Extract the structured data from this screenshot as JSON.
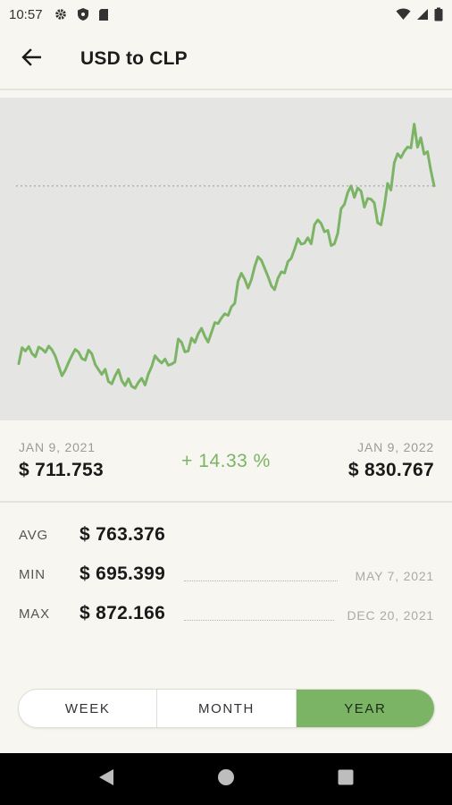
{
  "status_bar": {
    "time": "10:57"
  },
  "header": {
    "title": "USD to CLP"
  },
  "colors": {
    "accent": "#7cb466",
    "chart_bg": "#e5e5e3",
    "page_bg": "#f8f6f0"
  },
  "summary": {
    "start_date": "JAN 9, 2021",
    "start_value": "$ 711.753",
    "change": "+ 14.33 %",
    "end_date": "JAN 9, 2022",
    "end_value": "$ 830.767"
  },
  "stats": [
    {
      "label": "AVG",
      "value": "$ 763.376",
      "date": ""
    },
    {
      "label": "MIN",
      "value": "$ 695.399",
      "date": "MAY 7, 2021"
    },
    {
      "label": "MAX",
      "value": "$ 872.166",
      "date": "DEC 20, 2021"
    }
  ],
  "period_tabs": [
    {
      "label": "WEEK",
      "active": false
    },
    {
      "label": "MONTH",
      "active": false
    },
    {
      "label": "YEAR",
      "active": true
    }
  ],
  "chart_data": {
    "type": "line",
    "series": [
      {
        "values": [
          711.8,
          722.5,
          720.3,
          723.2,
          718.5,
          716.4,
          722.9,
          721.6,
          719.4,
          723.6,
          721.1,
          716.8,
          710.3,
          703.7,
          707.5,
          712.7,
          717.3,
          721.4,
          719.5,
          715.2,
          714.2,
          720.9,
          718.4,
          711.2,
          707.8,
          704.6,
          708.1,
          699.8,
          698.3,
          703.7,
          707.8,
          700.5,
          697.1,
          701.8,
          696.6,
          695.4,
          699.3,
          702.0,
          697.5,
          704.9,
          709.8,
          717.1,
          714.3,
          712.2,
          714.9,
          710.8,
          711.5,
          713.0,
          728.3,
          726.1,
          719.7,
          720.3,
          728.9,
          726.0,
          731.8,
          735.5,
          730.1,
          726.2,
          732.8,
          739.3,
          738.7,
          742.4,
          745.2,
          744.1,
          749.9,
          752.2,
          767.1,
          772.3,
          768.3,
          762.4,
          768.0,
          776.8,
          783.4,
          781.0,
          775.6,
          770.2,
          764.0,
          761.3,
          769.1,
          773.3,
          772.5,
          780.1,
          782.3,
          788.5,
          795.5,
          791.8,
          792.5,
          796.1,
          792.0,
          804.9,
          808.0,
          805.6,
          800.1,
          801.0,
          790.8,
          792.0,
          799.1,
          815.5,
          818.5,
          826.4,
          830.8,
          823.1,
          829.4,
          827.3,
          816.6,
          822.4,
          821.9,
          819.5,
          806.1,
          804.8,
          816.9,
          832.5,
          828.0,
          846.3,
          852.4,
          849.7,
          853.9,
          856.8,
          856.2,
          872.2,
          856.7,
          863.1,
          852.1,
          853.7,
          841.1,
          830.8
        ]
      }
    ],
    "dotted_reference": 830.767,
    "x_range": [
      "JAN 9, 2021",
      "JAN 9, 2022"
    ],
    "ylim": [
      690,
      878
    ],
    "grid": false,
    "legend": "none"
  }
}
